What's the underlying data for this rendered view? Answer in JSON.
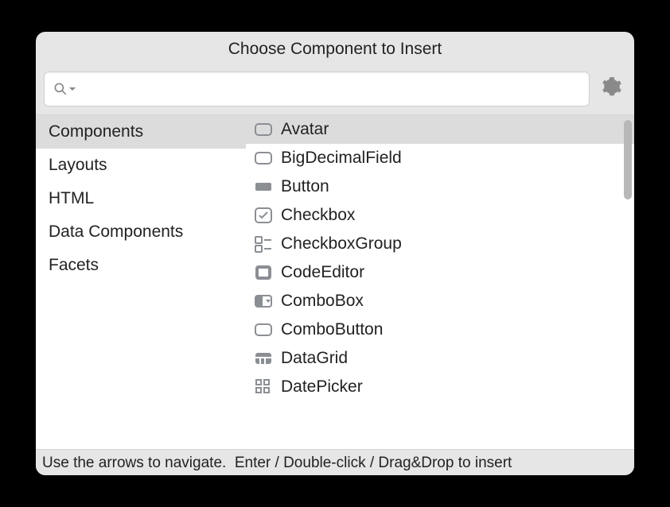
{
  "title": "Choose Component to Insert",
  "search": {
    "value": "",
    "placeholder": ""
  },
  "categories": [
    {
      "label": "Components",
      "selected": true
    },
    {
      "label": "Layouts",
      "selected": false
    },
    {
      "label": "HTML",
      "selected": false
    },
    {
      "label": "Data Components",
      "selected": false
    },
    {
      "label": "Facets",
      "selected": false
    }
  ],
  "components": [
    {
      "label": "Avatar",
      "icon": "avatar",
      "selected": true
    },
    {
      "label": "BigDecimalField",
      "icon": "field",
      "selected": false
    },
    {
      "label": "Button",
      "icon": "button",
      "selected": false
    },
    {
      "label": "Checkbox",
      "icon": "checkbox",
      "selected": false
    },
    {
      "label": "CheckboxGroup",
      "icon": "checkboxgroup",
      "selected": false
    },
    {
      "label": "CodeEditor",
      "icon": "codeeditor",
      "selected": false
    },
    {
      "label": "ComboBox",
      "icon": "combobox",
      "selected": false
    },
    {
      "label": "ComboButton",
      "icon": "field",
      "selected": false
    },
    {
      "label": "DataGrid",
      "icon": "datagrid",
      "selected": false
    },
    {
      "label": "DatePicker",
      "icon": "datepicker",
      "selected": false
    }
  ],
  "footer": "Use the arrows to navigate.  Enter / Double-click / Drag&Drop to insert",
  "colors": {
    "iconGray": "#8b8f94",
    "selectBg": "#dcdcdc"
  }
}
